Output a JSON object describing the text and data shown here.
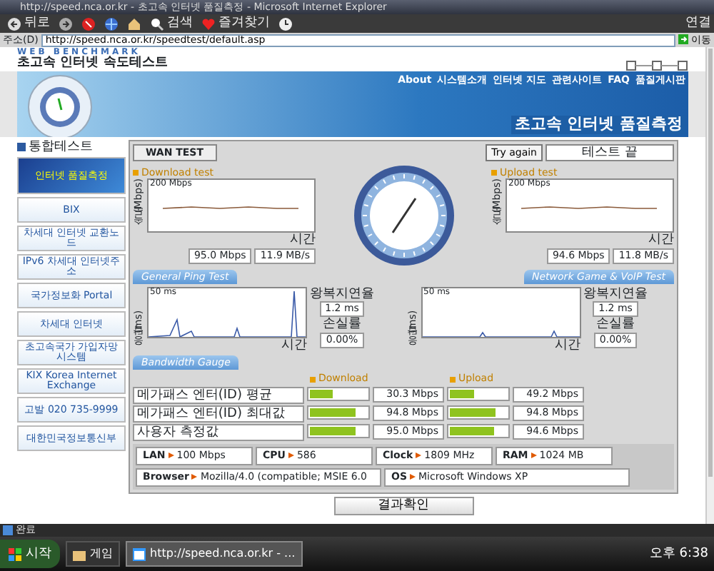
{
  "window": {
    "title": "http://speed.nca.or.kr - 초고속 인터넷 품질측정 - Microsoft Internet Explorer"
  },
  "toolbar": {
    "buttons": [
      {
        "kind": "back",
        "label": "뒤로"
      },
      {
        "kind": "forward"
      },
      {
        "kind": "stop"
      },
      {
        "kind": "refresh"
      },
      {
        "kind": "home"
      },
      {
        "kind": "search",
        "label": "검색"
      },
      {
        "kind": "favorites",
        "label": "즐겨찾기"
      },
      {
        "kind": "history"
      }
    ],
    "links": "연결"
  },
  "address_bar": {
    "label": "주소(D)",
    "value": "http://speed.nca.or.kr/speedtest/default.asp",
    "go": "이동"
  },
  "site": {
    "eyebrow": "WEB BENCHMARK",
    "title": "초고속 인터넷 속도테스트",
    "nav": [
      "About",
      "시스템소개",
      "인터넷 지도",
      "관련사이트",
      "FAQ",
      "품질게시판"
    ],
    "banner_title": "초고속 인터넷 품질측정"
  },
  "sidebar": {
    "heading": "통합테스트",
    "banners": [
      "인터넷 품질측정",
      "BIX",
      "차세대 인터넷 교환노드",
      "IPv6 차세대 인터넷주소",
      "국가정보화 Portal",
      "차세대 인터넷",
      "초고속국가 가입자망 시스템",
      "KIX Korea Internet Exchange",
      "고발 020 735-9999",
      "대한민국정보통신부"
    ]
  },
  "wan_test": {
    "tab": "WAN TEST",
    "try_again": "Try again",
    "status": "테스트 끝",
    "speed": [
      {
        "title": "Download test",
        "axis_max": "200 Mbps",
        "ylabel": "속도(Mbps)",
        "xlabel": "시간",
        "mbps": "95.0 Mbps",
        "mbs": "11.9 MB/s"
      },
      {
        "title": "Upload test",
        "axis_max": "200 Mbps",
        "ylabel": "속도(Mbps)",
        "xlabel": "시간",
        "mbps": "94.6 Mbps",
        "mbs": "11.8 MB/s"
      }
    ],
    "ping_tabs": [
      "General Ping Test",
      "Network Game & VoIP Test"
    ],
    "ping": [
      {
        "axis_max": "50 ms",
        "ylabel": "응답(ms)",
        "xlabel": "시간",
        "delay_label": "왕복지연율",
        "delay": "1.2 ms",
        "loss_label": "손실률",
        "loss": "0.00%"
      },
      {
        "axis_max": "50 ms",
        "ylabel": "응답(ms)",
        "xlabel": "시간",
        "delay_label": "왕복지연율",
        "delay": "1.2 ms",
        "loss_label": "손실률",
        "loss": "0.00%"
      }
    ],
    "bandwidth_tab": "Bandwidth Gauge",
    "bandwidth": {
      "headers": [
        "Download",
        "Upload"
      ],
      "rows": [
        {
          "label": "메가패스 엔터(ID) 평균",
          "download": {
            "level": 0.4,
            "value": "30.3 Mbps"
          },
          "upload": {
            "level": 0.42,
            "value": "49.2 Mbps"
          }
        },
        {
          "label": "메가패스 엔터(ID) 최대값",
          "download": {
            "level": 0.8,
            "value": "94.8 Mbps"
          },
          "upload": {
            "level": 0.8,
            "value": "94.8 Mbps"
          }
        },
        {
          "label": "사용자 측정값",
          "download": {
            "level": 0.8,
            "value": "95.0 Mbps"
          },
          "upload": {
            "level": 0.78,
            "value": "94.6 Mbps"
          }
        }
      ]
    },
    "system": [
      {
        "label": "LAN",
        "value": "100 Mbps"
      },
      {
        "label": "CPU",
        "value": "586"
      },
      {
        "label": "Clock",
        "value": "1809 MHz"
      },
      {
        "label": "RAM",
        "value": "1024 MB"
      },
      {
        "label": "Browser",
        "value": "Mozilla/4.0 (compatible; MSIE 6.0"
      },
      {
        "label": "OS",
        "value": "Microsoft Windows XP"
      }
    ],
    "result_button": "결과확인"
  },
  "status_bar": {
    "text": "완료"
  },
  "taskbar": {
    "start": "시작",
    "items": [
      {
        "label": "게임",
        "selected": false
      },
      {
        "label": "http://speed.nca.or.kr - ...",
        "selected": true
      }
    ],
    "clock": "오후 6:38"
  }
}
